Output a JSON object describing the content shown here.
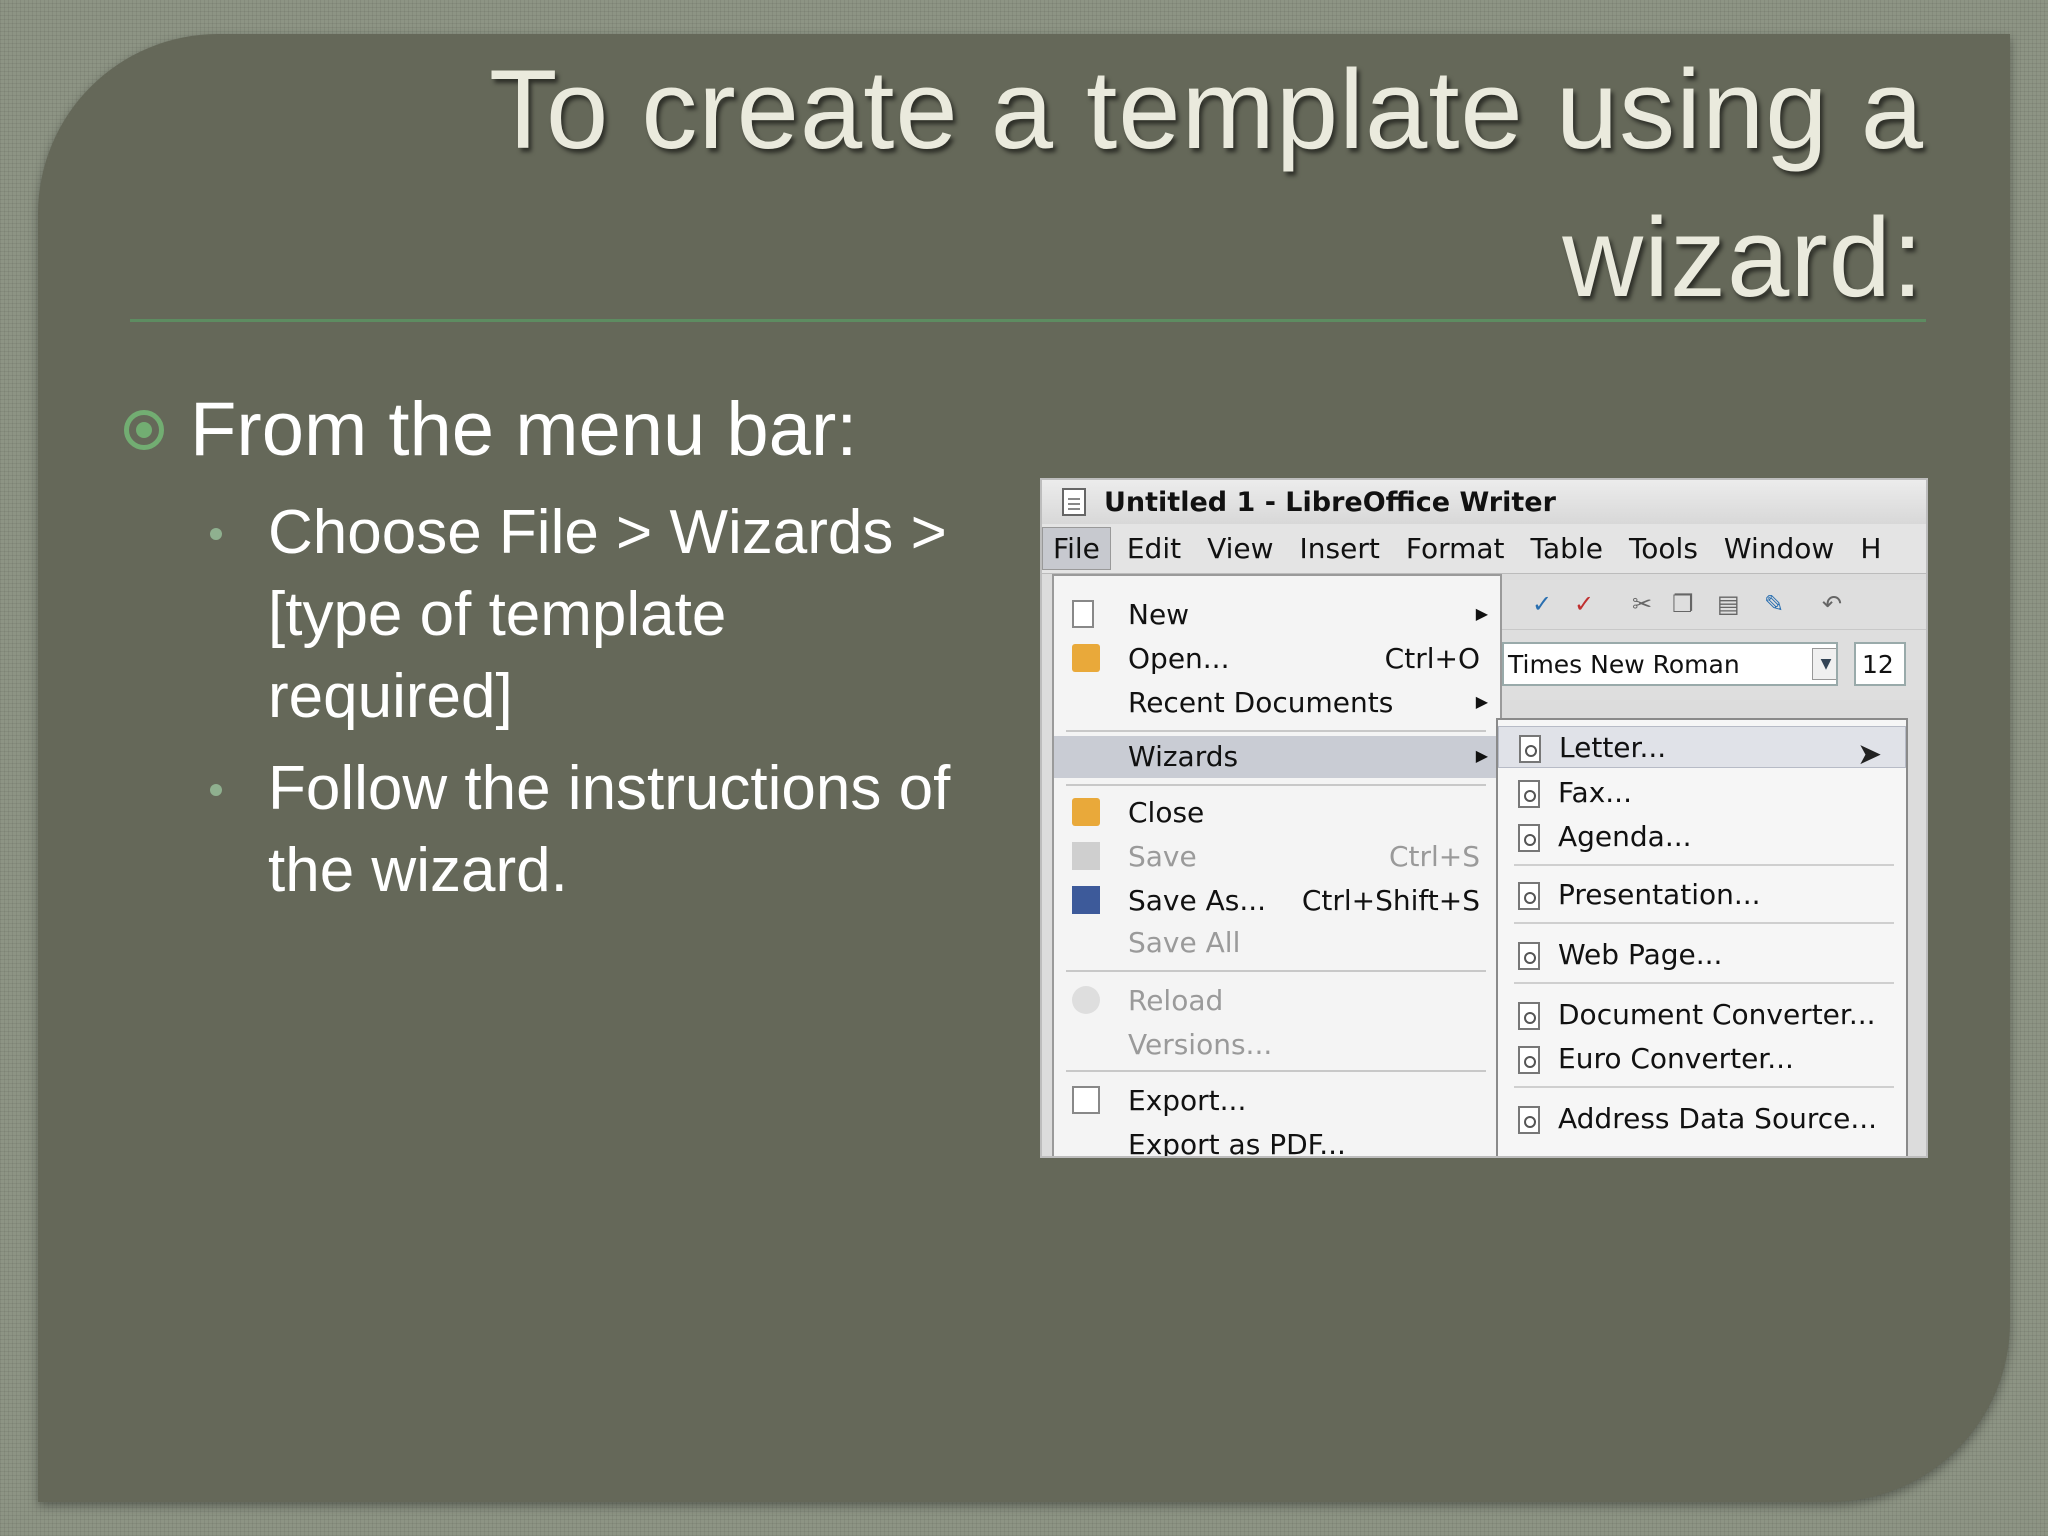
{
  "slide": {
    "title": "To create a template using a wizard:",
    "bullet1": "From the menu bar:",
    "bullet2": "Choose File > Wizards > [type of template required]",
    "bullet3": "Follow the instructions of the wizard."
  },
  "screenshot": {
    "window_title": "Untitled 1 - LibreOffice Writer",
    "menubar": [
      "File",
      "Edit",
      "View",
      "Insert",
      "Format",
      "Table",
      "Tools",
      "Window",
      "H"
    ],
    "font_name": "Times New Roman",
    "font_size": "12",
    "file_menu": {
      "new": "New",
      "open": "Open...",
      "open_shortcut": "Ctrl+O",
      "recent": "Recent Documents",
      "wizards": "Wizards",
      "close": "Close",
      "save": "Save",
      "save_shortcut": "Ctrl+S",
      "save_as": "Save As...",
      "save_as_shortcut": "Ctrl+Shift+S",
      "save_all": "Save All",
      "reload": "Reload",
      "versions": "Versions...",
      "export": "Export...",
      "export_pdf": "Export as PDF..."
    },
    "wizards_menu": [
      "Letter...",
      "Fax...",
      "Agenda...",
      "Presentation...",
      "Web Page...",
      "Document Converter...",
      "Euro Converter...",
      "Address Data Source..."
    ]
  },
  "icons": {
    "bullet": "circled-dot-icon",
    "cursor": "mouse-pointer-icon"
  },
  "colors": {
    "panel": "#656859",
    "accent": "#72ad72",
    "title": "#eaeadd"
  }
}
